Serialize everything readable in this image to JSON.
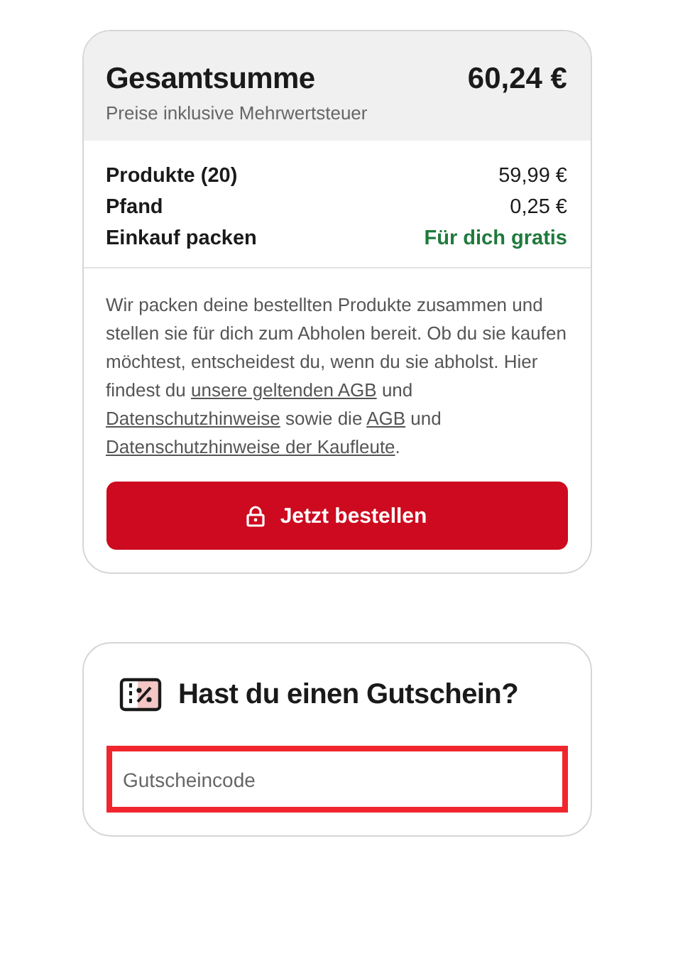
{
  "summary": {
    "title": "Gesamtsumme",
    "subtitle": "Preise inklusive Mehrwertsteuer",
    "total": "60,24 €",
    "lines": [
      {
        "label": "Produkte (20)",
        "value": "59,99 €",
        "kind": "price"
      },
      {
        "label": "Pfand",
        "value": "0,25 €",
        "kind": "price"
      },
      {
        "label": "Einkauf packen",
        "value": "Für dich gratis",
        "kind": "free"
      }
    ],
    "notice": [
      {
        "kind": "text",
        "text": "Wir packen deine bestellten Produkte zusammen und stellen sie für dich zum Abholen bereit. Ob du sie kaufen möchtest, entscheidest du, wenn du sie abholst. Hier findest du "
      },
      {
        "kind": "link",
        "text": "unsere geltenden AGB"
      },
      {
        "kind": "text",
        "text": " und "
      },
      {
        "kind": "link",
        "text": "Datenschutzhinweise"
      },
      {
        "kind": "text",
        "text": " sowie die "
      },
      {
        "kind": "link",
        "text": "AGB"
      },
      {
        "kind": "text",
        "text": " und "
      },
      {
        "kind": "link",
        "text": "Datenschutzhinweise der Kaufleute"
      },
      {
        "kind": "text",
        "text": "."
      }
    ],
    "order_button": "Jetzt bestellen"
  },
  "voucher": {
    "title": "Hast du einen Gutschein?",
    "field": {
      "placeholder": "Gutscheincode"
    }
  }
}
